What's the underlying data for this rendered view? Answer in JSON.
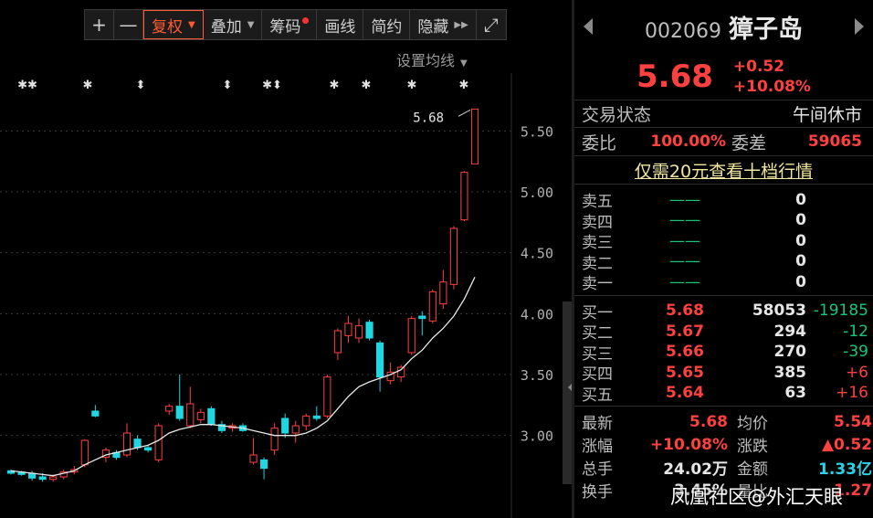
{
  "toolbar": {
    "items": [
      {
        "label": "+"
      },
      {
        "label": "—"
      },
      {
        "label": "复权"
      },
      {
        "label": "叠加"
      },
      {
        "label": "筹码"
      },
      {
        "label": "画线"
      },
      {
        "label": "简约"
      },
      {
        "label": "隐藏"
      },
      {
        "label": "⤢"
      }
    ]
  },
  "chart": {
    "ma_setting_label": "设置均线",
    "max_price_label": "5.68",
    "colors": {
      "up": "#ff4040",
      "down": "#20d6e0",
      "ma": "#e8e8e8",
      "grid": "#3a3a3a",
      "axis_text": "#b0b0b0"
    }
  },
  "chart_data": {
    "type": "candlestick",
    "y_ticks": [
      "5.50",
      "5.00",
      "4.50",
      "4.00",
      "3.50",
      "3.00"
    ],
    "ylim": [
      2.6,
      5.75
    ],
    "event_markers": [
      "✱✱",
      "✱",
      "⬍",
      "⬍",
      "✱⬍",
      "✱",
      "✱",
      "✱",
      "✱"
    ],
    "candles": [
      {
        "o": 2.71,
        "c": 2.69,
        "h": 2.72,
        "l": 2.68
      },
      {
        "o": 2.7,
        "c": 2.68,
        "h": 2.71,
        "l": 2.67
      },
      {
        "o": 2.69,
        "c": 2.65,
        "h": 2.71,
        "l": 2.63
      },
      {
        "o": 2.66,
        "c": 2.64,
        "h": 2.69,
        "l": 2.62
      },
      {
        "o": 2.64,
        "c": 2.66,
        "h": 2.68,
        "l": 2.62
      },
      {
        "o": 2.66,
        "c": 2.7,
        "h": 2.72,
        "l": 2.64
      },
      {
        "o": 2.7,
        "c": 2.72,
        "h": 2.75,
        "l": 2.68
      },
      {
        "o": 2.76,
        "c": 2.96,
        "h": 2.97,
        "l": 2.74
      },
      {
        "o": 3.2,
        "c": 3.16,
        "h": 3.25,
        "l": 3.15
      },
      {
        "o": 2.82,
        "c": 2.88,
        "h": 2.9,
        "l": 2.78
      },
      {
        "o": 2.86,
        "c": 2.82,
        "h": 2.88,
        "l": 2.8
      },
      {
        "o": 2.84,
        "c": 3.02,
        "h": 3.1,
        "l": 2.82
      },
      {
        "o": 2.97,
        "c": 2.9,
        "h": 3.0,
        "l": 2.88
      },
      {
        "o": 2.9,
        "c": 2.88,
        "h": 2.92,
        "l": 2.86
      },
      {
        "o": 2.8,
        "c": 3.08,
        "h": 3.1,
        "l": 2.78
      },
      {
        "o": 3.2,
        "c": 3.24,
        "h": 3.26,
        "l": 3.17
      },
      {
        "o": 3.24,
        "c": 3.14,
        "h": 3.5,
        "l": 3.12
      },
      {
        "o": 3.08,
        "c": 3.26,
        "h": 3.4,
        "l": 3.06
      },
      {
        "o": 3.13,
        "c": 3.19,
        "h": 3.22,
        "l": 3.1
      },
      {
        "o": 3.22,
        "c": 3.09,
        "h": 3.24,
        "l": 3.08
      },
      {
        "o": 3.09,
        "c": 3.04,
        "h": 3.12,
        "l": 3.02
      },
      {
        "o": 3.06,
        "c": 3.08,
        "h": 3.1,
        "l": 3.03
      },
      {
        "o": 3.08,
        "c": 3.04,
        "h": 3.1,
        "l": 3.03
      },
      {
        "o": 2.78,
        "c": 2.84,
        "h": 2.98,
        "l": 2.76
      },
      {
        "o": 2.8,
        "c": 2.73,
        "h": 2.82,
        "l": 2.64
      },
      {
        "o": 2.88,
        "c": 3.06,
        "h": 3.1,
        "l": 2.84
      },
      {
        "o": 3.14,
        "c": 3.02,
        "h": 3.18,
        "l": 2.98
      },
      {
        "o": 3.02,
        "c": 3.08,
        "h": 3.12,
        "l": 2.94
      },
      {
        "o": 3.08,
        "c": 3.16,
        "h": 3.18,
        "l": 3.04
      },
      {
        "o": 3.16,
        "c": 3.14,
        "h": 3.24,
        "l": 3.12
      },
      {
        "o": 3.16,
        "c": 3.48,
        "h": 3.5,
        "l": 3.14
      },
      {
        "o": 3.68,
        "c": 3.86,
        "h": 3.88,
        "l": 3.62
      },
      {
        "o": 3.82,
        "c": 3.92,
        "h": 3.98,
        "l": 3.76
      },
      {
        "o": 3.8,
        "c": 3.9,
        "h": 3.96,
        "l": 3.76
      },
      {
        "o": 3.93,
        "c": 3.8,
        "h": 3.95,
        "l": 3.78
      },
      {
        "o": 3.76,
        "c": 3.48,
        "h": 3.78,
        "l": 3.36
      },
      {
        "o": 3.45,
        "c": 3.52,
        "h": 3.6,
        "l": 3.42
      },
      {
        "o": 3.48,
        "c": 3.56,
        "h": 3.58,
        "l": 3.44
      },
      {
        "o": 3.68,
        "c": 3.96,
        "h": 3.98,
        "l": 3.66
      },
      {
        "o": 3.98,
        "c": 3.96,
        "h": 4.02,
        "l": 3.82
      },
      {
        "o": 3.94,
        "c": 4.18,
        "h": 4.2,
        "l": 3.92
      },
      {
        "o": 4.08,
        "c": 4.26,
        "h": 4.36,
        "l": 4.04
      },
      {
        "o": 4.24,
        "c": 4.7,
        "h": 4.72,
        "l": 4.2
      },
      {
        "o": 4.77,
        "c": 5.16,
        "h": 5.17,
        "l": 4.76
      },
      {
        "o": 5.23,
        "c": 5.68,
        "h": 5.68,
        "l": 5.23
      }
    ],
    "ma": [
      2.71,
      2.7,
      2.69,
      2.68,
      2.67,
      2.69,
      2.71,
      2.76,
      2.8,
      2.84,
      2.86,
      2.88,
      2.9,
      2.92,
      2.96,
      3.02,
      3.05,
      3.07,
      3.09,
      3.09,
      3.08,
      3.07,
      3.06,
      3.04,
      3.02,
      3.0,
      3.0,
      3.0,
      3.02,
      3.06,
      3.12,
      3.22,
      3.32,
      3.4,
      3.44,
      3.47,
      3.5,
      3.54,
      3.63,
      3.7,
      3.8,
      3.88,
      3.98,
      4.12,
      4.3
    ]
  },
  "panel": {
    "code": "002069",
    "name": "獐子岛",
    "price": "5.68",
    "change": "+0.52",
    "change_pct": "+10.08%",
    "trade_status_label": "交易状态",
    "trade_status": "午间休市",
    "weibi_label": "委比",
    "weibi": "100.00%",
    "weicha_label": "委差",
    "weicha": "59065",
    "link_text": "仅需20元查看十档行情",
    "asks": [
      {
        "label": "卖五",
        "price": "——",
        "vol": "0",
        "chg": ""
      },
      {
        "label": "卖四",
        "price": "——",
        "vol": "0",
        "chg": ""
      },
      {
        "label": "卖三",
        "price": "——",
        "vol": "0",
        "chg": ""
      },
      {
        "label": "卖二",
        "price": "——",
        "vol": "0",
        "chg": ""
      },
      {
        "label": "卖一",
        "price": "——",
        "vol": "0",
        "chg": ""
      }
    ],
    "bids": [
      {
        "label": "买一",
        "price": "5.68",
        "vol": "58053",
        "chg": "-19185"
      },
      {
        "label": "买二",
        "price": "5.67",
        "vol": "294",
        "chg": "-12"
      },
      {
        "label": "买三",
        "price": "5.66",
        "vol": "270",
        "chg": "-39"
      },
      {
        "label": "买四",
        "price": "5.65",
        "vol": "385",
        "chg": "+6"
      },
      {
        "label": "买五",
        "price": "5.64",
        "vol": "63",
        "chg": "+16"
      }
    ],
    "stats": [
      {
        "k1": "最新",
        "v1": "5.68",
        "k2": "均价",
        "v2": "5.54"
      },
      {
        "k1": "涨幅",
        "v1": "+10.08%",
        "k2": "涨跌",
        "v2": "▲0.52"
      },
      {
        "k1": "总手",
        "v1": "24.02万",
        "k2": "金额",
        "v2": "1.33亿"
      },
      {
        "k1": "换手",
        "v1": "3.45%",
        "k2": "量比",
        "v2": "1.27"
      }
    ]
  },
  "watermark": "凤凰社区@外汇天眼"
}
